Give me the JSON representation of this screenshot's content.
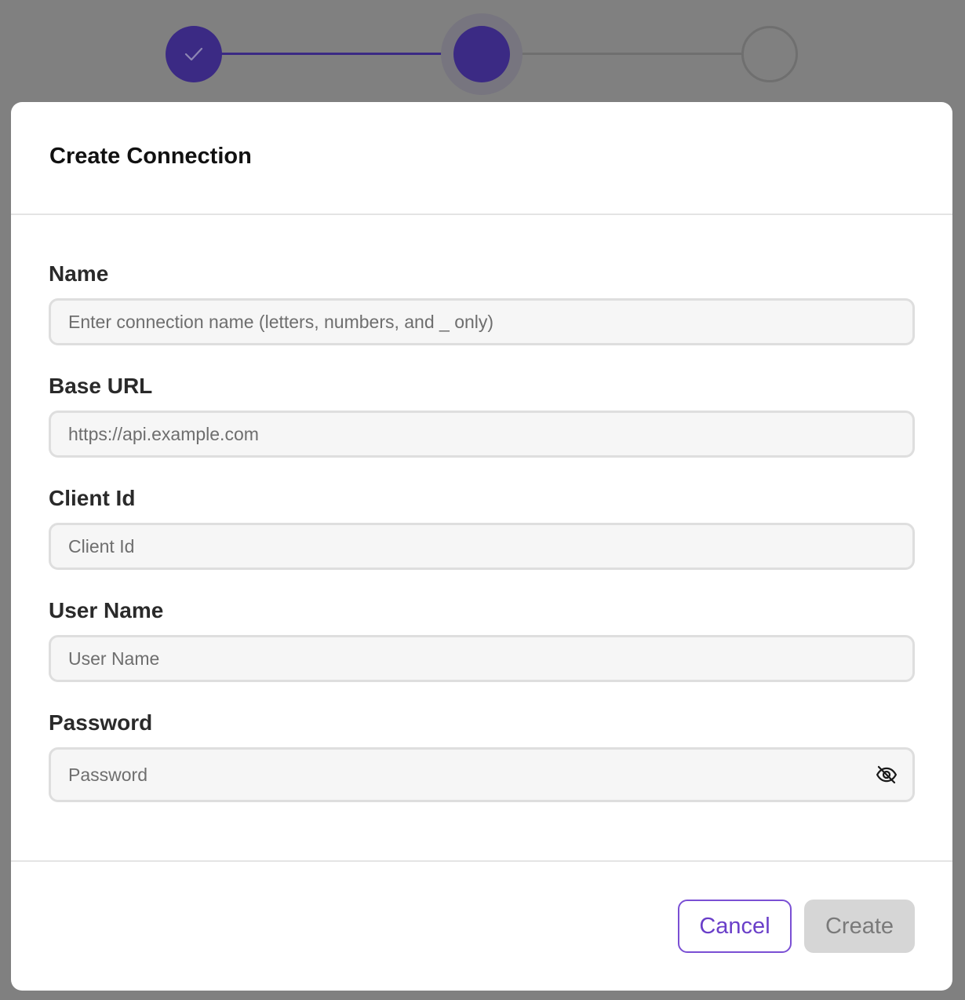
{
  "stepper": {
    "steps": [
      {
        "state": "complete",
        "icon": "check-icon"
      },
      {
        "state": "current"
      },
      {
        "state": "pending"
      }
    ],
    "colors": {
      "active": "#3b2a84",
      "inactive": "#6f6f6f"
    }
  },
  "modal": {
    "title": "Create Connection"
  },
  "form": {
    "name": {
      "label": "Name",
      "value": "",
      "placeholder": "Enter connection name (letters, numbers, and _ only)"
    },
    "base_url": {
      "label": "Base URL",
      "value": "",
      "placeholder": "https://api.example.com"
    },
    "client_id": {
      "label": "Client Id",
      "value": "",
      "placeholder": "Client Id"
    },
    "user_name": {
      "label": "User Name",
      "value": "",
      "placeholder": "User Name"
    },
    "password": {
      "label": "Password",
      "value": "",
      "placeholder": "Password",
      "toggle_icon": "eye-off-icon"
    }
  },
  "footer": {
    "cancel_label": "Cancel",
    "create_label": "Create",
    "accent_color": "#6a3fc9"
  }
}
